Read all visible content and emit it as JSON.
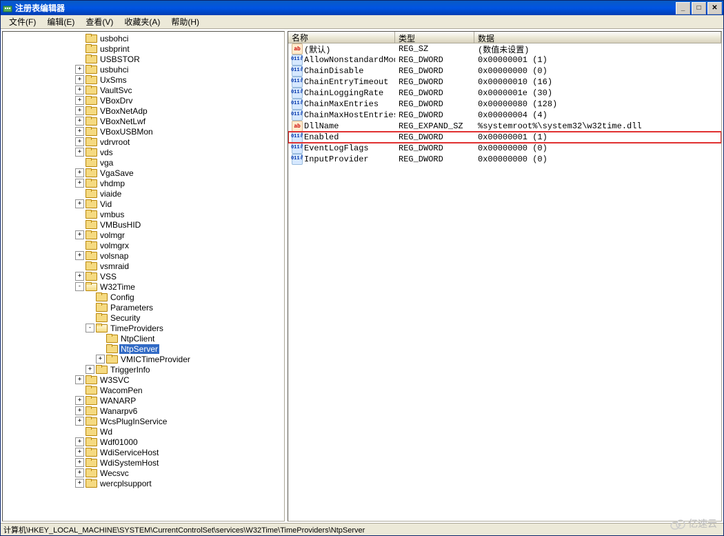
{
  "window": {
    "title": "注册表编辑器"
  },
  "menu": {
    "file": "文件(F)",
    "edit": "编辑(E)",
    "view": "查看(V)",
    "favorites": "收藏夹(A)",
    "help": "帮助(H)"
  },
  "tree": {
    "items": [
      {
        "indent": 7,
        "toggle": "",
        "label": "usbohci"
      },
      {
        "indent": 7,
        "toggle": "",
        "label": "usbprint"
      },
      {
        "indent": 7,
        "toggle": "",
        "label": "USBSTOR"
      },
      {
        "indent": 7,
        "toggle": "+",
        "label": "usbuhci"
      },
      {
        "indent": 7,
        "toggle": "+",
        "label": "UxSms"
      },
      {
        "indent": 7,
        "toggle": "+",
        "label": "VaultSvc"
      },
      {
        "indent": 7,
        "toggle": "+",
        "label": "VBoxDrv"
      },
      {
        "indent": 7,
        "toggle": "+",
        "label": "VBoxNetAdp"
      },
      {
        "indent": 7,
        "toggle": "+",
        "label": "VBoxNetLwf"
      },
      {
        "indent": 7,
        "toggle": "+",
        "label": "VBoxUSBMon"
      },
      {
        "indent": 7,
        "toggle": "+",
        "label": "vdrvroot"
      },
      {
        "indent": 7,
        "toggle": "+",
        "label": "vds"
      },
      {
        "indent": 7,
        "toggle": "",
        "label": "vga"
      },
      {
        "indent": 7,
        "toggle": "+",
        "label": "VgaSave"
      },
      {
        "indent": 7,
        "toggle": "+",
        "label": "vhdmp"
      },
      {
        "indent": 7,
        "toggle": "",
        "label": "viaide"
      },
      {
        "indent": 7,
        "toggle": "+",
        "label": "Vid"
      },
      {
        "indent": 7,
        "toggle": "",
        "label": "vmbus"
      },
      {
        "indent": 7,
        "toggle": "",
        "label": "VMBusHID"
      },
      {
        "indent": 7,
        "toggle": "+",
        "label": "volmgr"
      },
      {
        "indent": 7,
        "toggle": "",
        "label": "volmgrx"
      },
      {
        "indent": 7,
        "toggle": "+",
        "label": "volsnap"
      },
      {
        "indent": 7,
        "toggle": "",
        "label": "vsmraid"
      },
      {
        "indent": 7,
        "toggle": "+",
        "label": "VSS"
      },
      {
        "indent": 7,
        "toggle": "-",
        "label": "W32Time",
        "open": true
      },
      {
        "indent": 8,
        "toggle": "",
        "label": "Config"
      },
      {
        "indent": 8,
        "toggle": "",
        "label": "Parameters"
      },
      {
        "indent": 8,
        "toggle": "",
        "label": "Security"
      },
      {
        "indent": 8,
        "toggle": "-",
        "label": "TimeProviders",
        "open": true
      },
      {
        "indent": 9,
        "toggle": "",
        "label": "NtpClient"
      },
      {
        "indent": 9,
        "toggle": "",
        "label": "NtpServer",
        "selected": true
      },
      {
        "indent": 9,
        "toggle": "+",
        "label": "VMICTimeProvider"
      },
      {
        "indent": 8,
        "toggle": "+",
        "label": "TriggerInfo"
      },
      {
        "indent": 7,
        "toggle": "+",
        "label": "W3SVC"
      },
      {
        "indent": 7,
        "toggle": "",
        "label": "WacomPen"
      },
      {
        "indent": 7,
        "toggle": "+",
        "label": "WANARP"
      },
      {
        "indent": 7,
        "toggle": "+",
        "label": "Wanarpv6"
      },
      {
        "indent": 7,
        "toggle": "+",
        "label": "WcsPlugInService"
      },
      {
        "indent": 7,
        "toggle": "",
        "label": "Wd"
      },
      {
        "indent": 7,
        "toggle": "+",
        "label": "Wdf01000"
      },
      {
        "indent": 7,
        "toggle": "+",
        "label": "WdiServiceHost"
      },
      {
        "indent": 7,
        "toggle": "+",
        "label": "WdiSystemHost"
      },
      {
        "indent": 7,
        "toggle": "+",
        "label": "Wecsvc"
      },
      {
        "indent": 7,
        "toggle": "+",
        "label": "wercplsupport"
      }
    ]
  },
  "list": {
    "headers": {
      "name": "名称",
      "type": "类型",
      "data": "数据"
    },
    "rows": [
      {
        "icon": "sz",
        "name": "(默认)",
        "type": "REG_SZ",
        "data": "(数值未设置)"
      },
      {
        "icon": "dw",
        "name": "AllowNonstandardMod…",
        "type": "REG_DWORD",
        "data": "0x00000001 (1)"
      },
      {
        "icon": "dw",
        "name": "ChainDisable",
        "type": "REG_DWORD",
        "data": "0x00000000 (0)"
      },
      {
        "icon": "dw",
        "name": "ChainEntryTimeout",
        "type": "REG_DWORD",
        "data": "0x00000010 (16)"
      },
      {
        "icon": "dw",
        "name": "ChainLoggingRate",
        "type": "REG_DWORD",
        "data": "0x0000001e (30)"
      },
      {
        "icon": "dw",
        "name": "ChainMaxEntries",
        "type": "REG_DWORD",
        "data": "0x00000080 (128)"
      },
      {
        "icon": "dw",
        "name": "ChainMaxHostEntries",
        "type": "REG_DWORD",
        "data": "0x00000004 (4)"
      },
      {
        "icon": "sz",
        "name": "DllName",
        "type": "REG_EXPAND_SZ",
        "data": "%systemroot%\\system32\\w32time.dll"
      },
      {
        "icon": "dw",
        "name": "Enabled",
        "type": "REG_DWORD",
        "data": "0x00000001 (1)",
        "highlighted": true
      },
      {
        "icon": "dw",
        "name": "EventLogFlags",
        "type": "REG_DWORD",
        "data": "0x00000000 (0)"
      },
      {
        "icon": "dw",
        "name": "InputProvider",
        "type": "REG_DWORD",
        "data": "0x00000000 (0)"
      }
    ]
  },
  "statusbar": "计算机\\HKEY_LOCAL_MACHINE\\SYSTEM\\CurrentControlSet\\services\\W32Time\\TimeProviders\\NtpServer",
  "watermark": "亿速云"
}
